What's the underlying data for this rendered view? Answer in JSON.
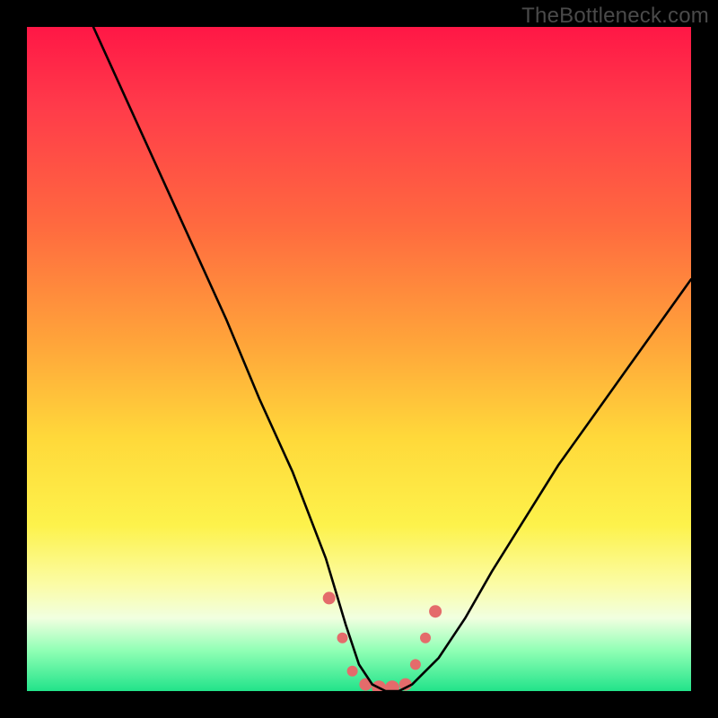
{
  "watermark": "TheBottleneck.com",
  "chart_data": {
    "type": "line",
    "title": "",
    "xlabel": "",
    "ylabel": "",
    "xlim": [
      0,
      100
    ],
    "ylim": [
      0,
      100
    ],
    "series": [
      {
        "name": "bottleneck-curve",
        "x": [
          10,
          15,
          20,
          25,
          30,
          35,
          40,
          45,
          48,
          50,
          52,
          54,
          56,
          58,
          62,
          66,
          70,
          75,
          80,
          85,
          90,
          95,
          100
        ],
        "values": [
          100,
          89,
          78,
          67,
          56,
          44,
          33,
          20,
          10,
          4,
          1,
          0,
          0,
          1,
          5,
          11,
          18,
          26,
          34,
          41,
          48,
          55,
          62
        ]
      }
    ],
    "markers": {
      "name": "highlight-dots",
      "color": "#e46b6b",
      "points_x": [
        45.5,
        47.5,
        49,
        51,
        53,
        55,
        57,
        58.5,
        60,
        61.5
      ],
      "points_y": [
        14,
        8,
        3,
        1,
        0.5,
        0.5,
        1,
        4,
        8,
        12
      ],
      "radius": [
        7,
        6,
        6,
        7,
        8,
        8,
        7,
        6,
        6,
        7
      ]
    }
  }
}
